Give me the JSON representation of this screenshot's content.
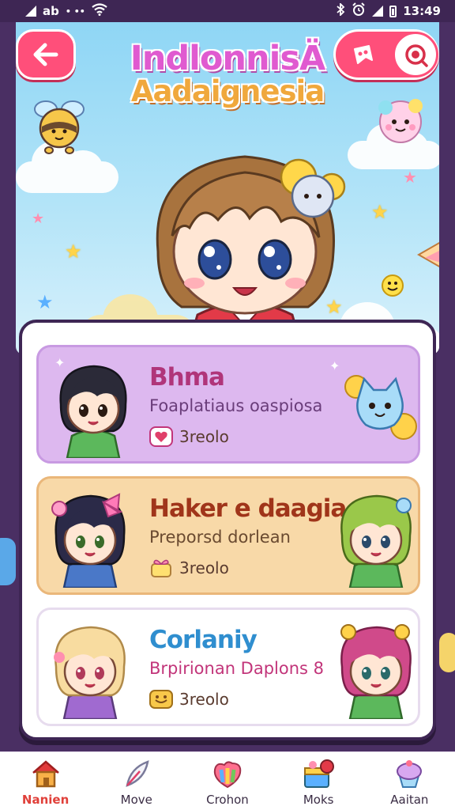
{
  "status_bar": {
    "left_text": "ab",
    "left_dots": "• ••",
    "time": "13:49"
  },
  "header": {
    "title_line1": "IndlonnisÄ",
    "title_line2": "Aadaignesia",
    "back_icon": "arrow-left-icon",
    "game_icon": "controller-icon",
    "search_icon": "search-icon"
  },
  "cards": [
    {
      "title": "Bhma",
      "subtitle": "Foaplatiaus oaspiosa",
      "meta": "3reolo",
      "meta_icon": "heart-icon",
      "title_color": "#b0357a",
      "subtitle_color": "#6a3d7a"
    },
    {
      "title": "Haker e daagia",
      "subtitle": "Preporsd dorlean",
      "meta": "3reolo",
      "meta_icon": "gift-icon",
      "title_color": "#a0351a",
      "subtitle_color": "#6a4a30"
    },
    {
      "title": "Corlaniy",
      "subtitle": "Brpirionan Daplons 8",
      "meta": "3reolo",
      "meta_icon": "treasure-icon",
      "title_color": "#2f8ecf",
      "subtitle_color": "#c2357a"
    }
  ],
  "bottom_nav": [
    {
      "label": "Nanien",
      "icon": "home-icon",
      "active": true
    },
    {
      "label": "Move",
      "icon": "feather-icon",
      "active": false
    },
    {
      "label": "Crohon",
      "icon": "paint-palette-icon",
      "active": false
    },
    {
      "label": "Moks",
      "icon": "gift-box-icon",
      "active": false
    },
    {
      "label": "Aaitan",
      "icon": "cupcake-icon",
      "active": false
    }
  ],
  "colors": {
    "accent": "#ff4f7a",
    "frame": "#4a2f63",
    "sky": "#8fd6f5"
  }
}
